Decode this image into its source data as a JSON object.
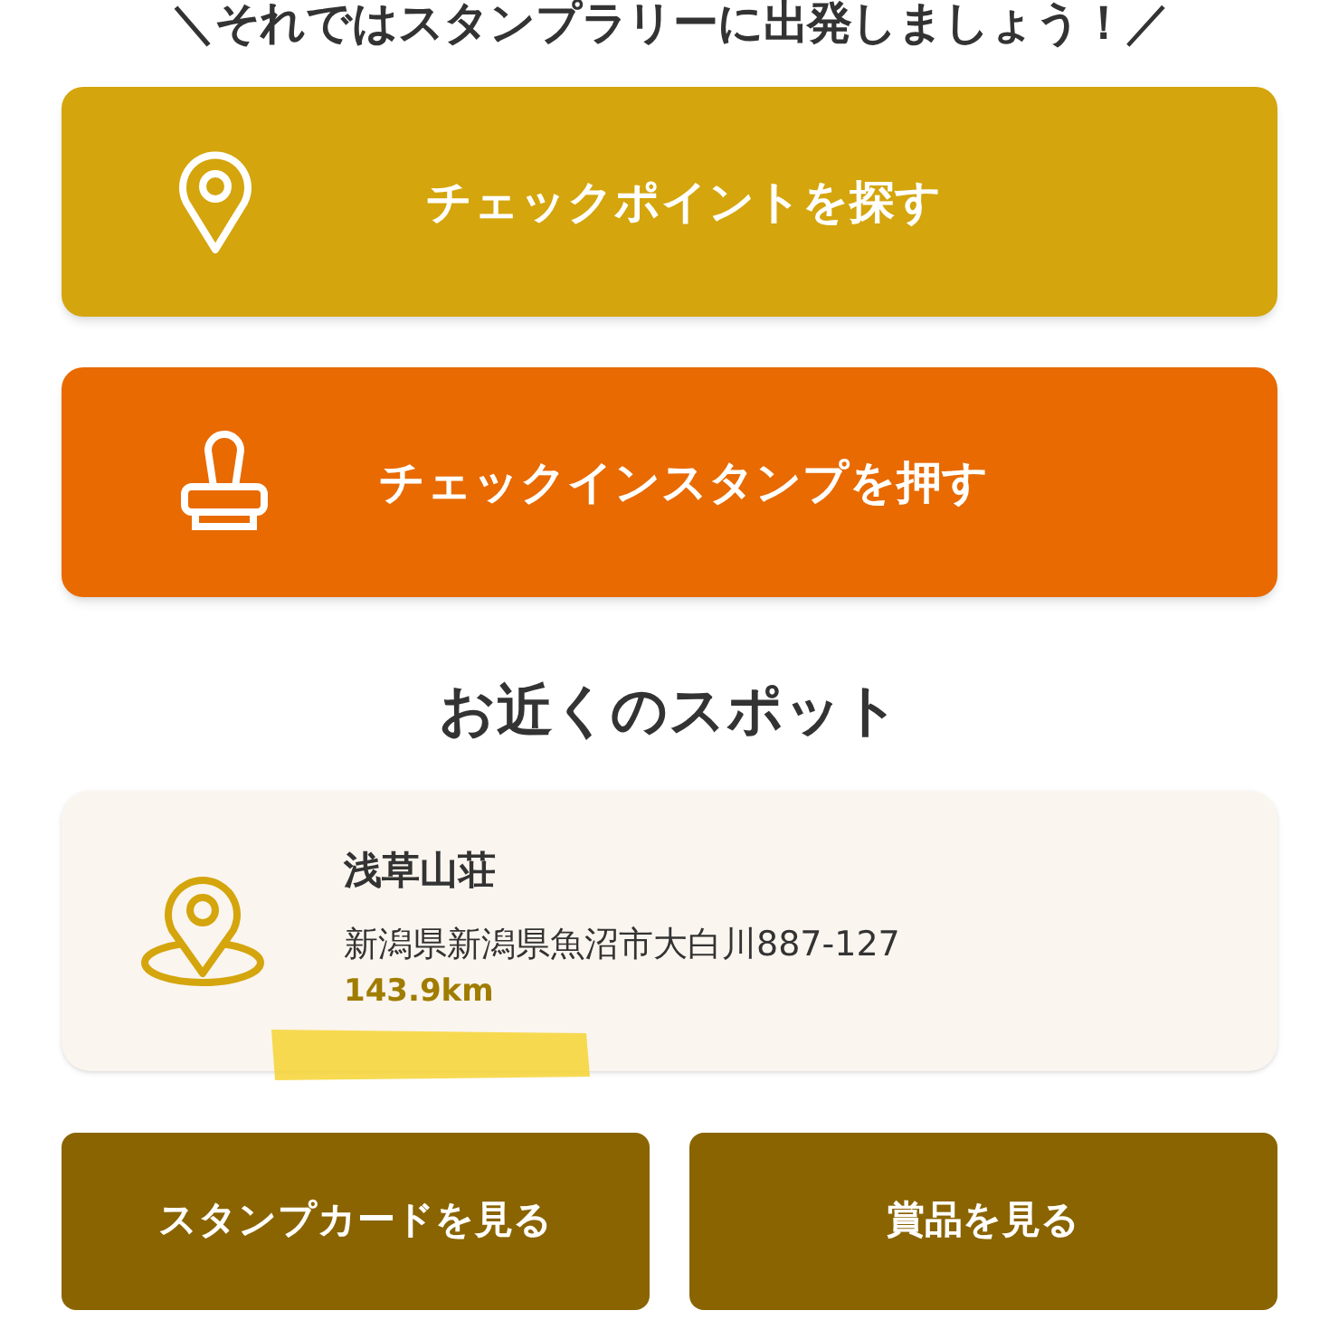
{
  "banner": "＼それではスタンプラリーに出発しましょう！／",
  "actions": [
    {
      "kind": "find",
      "label": "チェックポイントを探す"
    },
    {
      "kind": "stamp",
      "label": "チェックインスタンプを押す"
    }
  ],
  "nearby": {
    "heading": "お近くのスポット",
    "spots": [
      {
        "name": "浅草山荘",
        "address": "新潟県新潟県魚沼市大白川887-127",
        "distance": "143.9km"
      }
    ]
  },
  "bottom_buttons": [
    "スタンプカードを見る",
    "賞品を見る"
  ]
}
